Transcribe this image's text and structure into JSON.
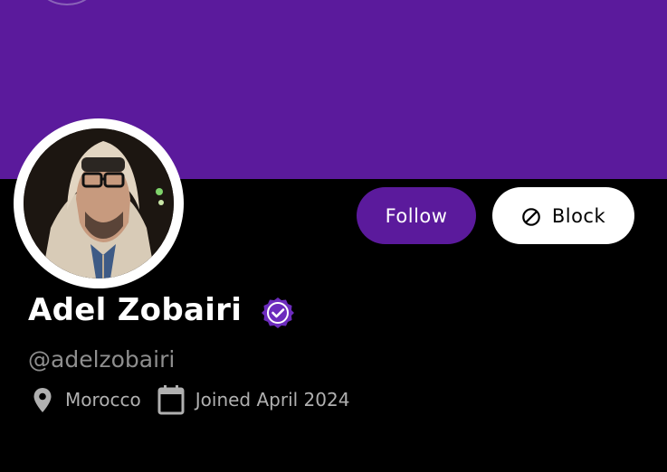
{
  "profile": {
    "name": "Adel Zobairi",
    "handle": "@adelzobairi",
    "location": "Morocco",
    "joined": "Joined April 2024",
    "verified": true
  },
  "actions": {
    "follow_label": "Follow",
    "block_label": "Block"
  },
  "icons": {
    "verified": "verified-badge-icon",
    "block": "block-icon",
    "location": "location-pin-icon",
    "calendar": "calendar-icon"
  },
  "colors": {
    "accent": "#5b1a9c",
    "background": "#000000",
    "text_primary": "#ffffff",
    "text_secondary": "#8e8e8e"
  }
}
